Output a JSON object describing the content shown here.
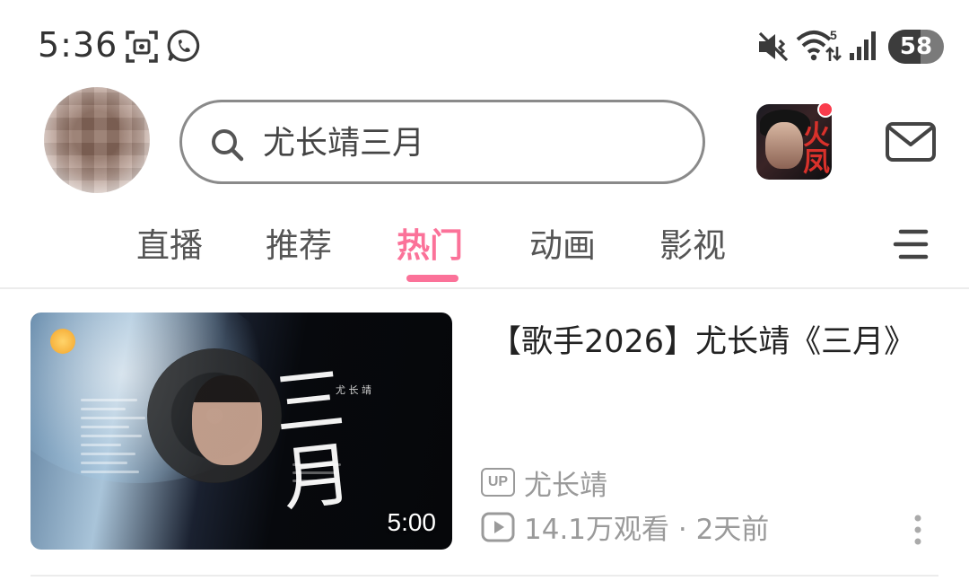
{
  "status_bar": {
    "time": "5:36",
    "battery_level": 58,
    "battery_text": "58",
    "wifi_badge": "5",
    "icons": [
      "screenshot-icon",
      "whatsapp-icon",
      "mute-icon",
      "wifi-icon",
      "signal-icon",
      "battery-icon"
    ]
  },
  "header": {
    "search_text": "尤长靖三月",
    "game_icon_glyph": "火凤"
  },
  "tabs": [
    {
      "label": "直播",
      "active": false
    },
    {
      "label": "推荐",
      "active": false
    },
    {
      "label": "热门",
      "active": true
    },
    {
      "label": "动画",
      "active": false
    },
    {
      "label": "影视",
      "active": false
    }
  ],
  "video": {
    "title": "【歌手2026】尤长靖《三月》",
    "duration": "5:00",
    "thumbnail_title": "三月",
    "thumbnail_artist": "尤 长 靖",
    "up_badge": "UP",
    "uploader": "尤长靖",
    "stats": "14.1万观看 · 2天前"
  },
  "colors": {
    "accent": "#fb7299",
    "text_secondary": "#9a9a9a",
    "notification_dot": "#fa3c4c"
  }
}
